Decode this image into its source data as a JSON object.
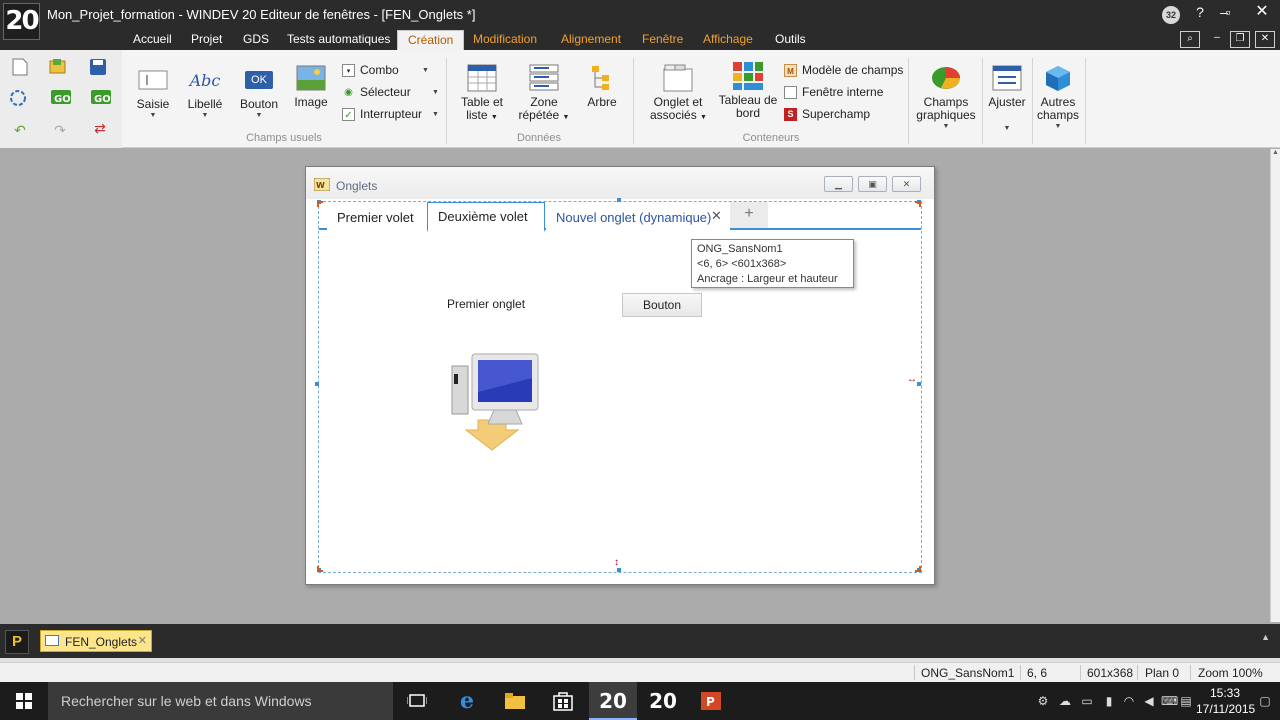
{
  "titlebar": {
    "logo": "20",
    "title": "Mon_Projet_formation - WINDEV 20  Editeur de fenêtres - [FEN_Onglets *]",
    "badge": "32"
  },
  "ribbon_tabs": [
    "Accueil",
    "Projet",
    "GDS",
    "Tests automatiques",
    "Création",
    "Modification",
    "Alignement",
    "Fenêtre",
    "Affichage",
    "Outils"
  ],
  "ribbon": {
    "champs_usuels": {
      "group_label": "Champs usuels",
      "saisie": "Saisie",
      "libelle": "Libellé",
      "libelle_icon_text": "Abc",
      "bouton": "Bouton",
      "bouton_icon_text": "OK",
      "image": "Image",
      "combo": "Combo",
      "selecteur": "Sélecteur",
      "interrupteur": "Interrupteur"
    },
    "donnees": {
      "group_label": "Données",
      "table_line1": "Table et",
      "table_line2": "liste",
      "zone_line1": "Zone",
      "zone_line2": "répétée",
      "arbre": "Arbre"
    },
    "conteneurs": {
      "group_label": "Conteneurs",
      "onglet_line1": "Onglet et",
      "onglet_line2": "associés",
      "tableau_line1": "Tableau de",
      "tableau_line2": "bord",
      "modele": "Modèle de champs",
      "fenetre_interne": "Fenêtre interne",
      "superchamp": "Superchamp"
    },
    "extra": {
      "champs_line1": "Champs",
      "champs_line2": "graphiques",
      "ajuster": "Ajuster",
      "autres_line1": "Autres",
      "autres_line2": "champs"
    }
  },
  "designer": {
    "window_title": "Onglets",
    "tabs": [
      "Premier volet",
      "Deuxième volet",
      "Nouvel onglet (dynamique)"
    ],
    "tab_close": "✕",
    "tab_add": "+",
    "tooltip": {
      "line1": "ONG_SansNom1",
      "line2": "<6, 6> <601x368>",
      "line3": "Ancrage : Largeur et hauteur"
    },
    "label": "Premier onglet",
    "button": "Bouton"
  },
  "doc_tabs": {
    "p_icon": "P",
    "active_tab": "FEN_Onglets",
    "close": "✕"
  },
  "statusbar": {
    "control_name": "ONG_SansNom1",
    "position": "6, 6",
    "size": "601x368",
    "plan": "Plan 0",
    "zoom": "Zoom 100%"
  },
  "taskbar": {
    "search_placeholder": "Rechercher sur le web et dans Windows",
    "app1": "20",
    "app2": "20",
    "time": "15:33",
    "date": "17/11/2015"
  }
}
